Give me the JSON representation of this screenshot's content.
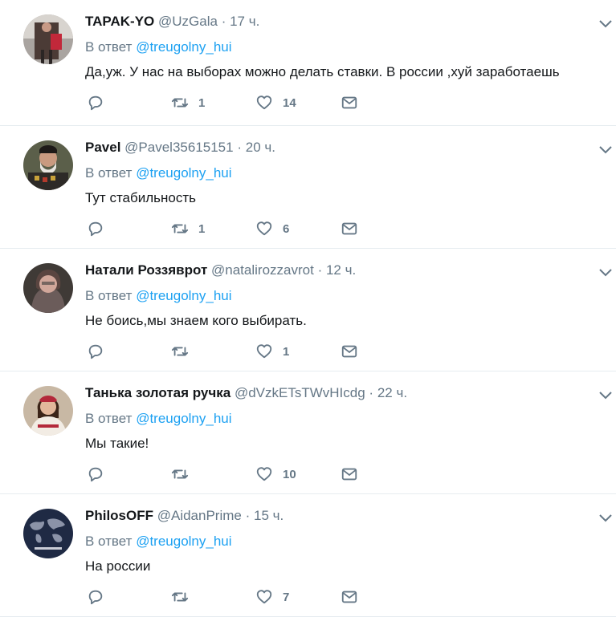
{
  "reply_prefix": "В ответ",
  "tweets": [
    {
      "name": "TAPAK-YO",
      "handle": "@UzGala",
      "time": "17 ч.",
      "reply_to": "@treugolny_hui",
      "text": "Да,уж. У нас на выборах можно делать ставки. В россии ,хуй заработаешь",
      "retweets": "1",
      "likes": "14"
    },
    {
      "name": "Pavel",
      "handle": "@Pavel35615151",
      "time": "20 ч.",
      "reply_to": "@treugolny_hui",
      "text": "Тут стабильность",
      "retweets": "1",
      "likes": "6"
    },
    {
      "name": "Натали Роззяврот",
      "handle": "@natalirozzavrot",
      "time": "12 ч.",
      "reply_to": "@treugolny_hui",
      "text": "Не боись,мы знаем кого выбирать.",
      "retweets": "",
      "likes": "1"
    },
    {
      "name": "Танька золотая ручка",
      "handle": "@dVzkETsTWvHIcdg",
      "time": "22 ч.",
      "reply_to": "@treugolny_hui",
      "text": "Мы такие!",
      "retweets": "",
      "likes": "10"
    },
    {
      "name": "PhilosOFF",
      "handle": "@AidanPrime",
      "time": "15 ч.",
      "reply_to": "@treugolny_hui",
      "text": "На россии",
      "retweets": "",
      "likes": "7"
    }
  ],
  "colors": {
    "link": "#1da1f2",
    "secondary": "#657786",
    "text": "#14171a",
    "border": "#e6ecf0"
  },
  "icons": [
    "reply-icon",
    "retweet-icon",
    "like-icon",
    "direct-message-icon",
    "chevron-down-icon"
  ]
}
